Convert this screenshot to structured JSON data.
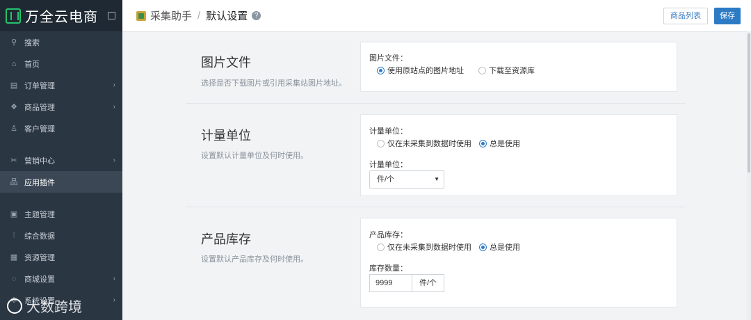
{
  "sidebar": {
    "brand": "万全云电商",
    "items": [
      {
        "label": "搜索"
      },
      {
        "label": "首页"
      },
      {
        "label": "订单管理"
      },
      {
        "label": "商品管理"
      },
      {
        "label": "客户管理"
      },
      {
        "label": "营销中心"
      },
      {
        "label": "应用插件"
      },
      {
        "label": "主题管理"
      },
      {
        "label": "综合数据"
      },
      {
        "label": "资源管理"
      },
      {
        "label": "商城设置"
      },
      {
        "label": "系统设置"
      }
    ],
    "watermark": "大数跨境"
  },
  "header": {
    "breadcrumb_app": "采集助手",
    "breadcrumb_sep": "/",
    "breadcrumb_current": "默认设置",
    "help_glyph": "?",
    "product_list_label": "商品列表",
    "save_label": "保存"
  },
  "sections": {
    "image": {
      "title": "图片文件",
      "desc": "选择是否下载图片或引用采集站图片地址。",
      "field_label": "图片文件：",
      "option_a": "使用原站点的图片地址",
      "option_b": "下载至资源库"
    },
    "unit": {
      "title": "计量单位",
      "desc": "设置默认计量单位及何时使用。",
      "field_label": "计量单位：",
      "option_a": "仅在未采集到数据时使用",
      "option_b": "总是使用",
      "select_label": "计量单位：",
      "select_value": "件/个"
    },
    "stock": {
      "title": "产品库存",
      "desc": "设置默认产品库存及何时使用。",
      "field_label": "产品库存：",
      "option_a": "仅在未采集到数据时使用",
      "option_b": "总是使用",
      "qty_label": "库存数量：",
      "qty_value": "9999",
      "qty_unit": "件/个"
    }
  },
  "colors": {
    "sidebar_bg": "#2b3643",
    "accent": "#2d7bc5",
    "brand_green": "#27c26c"
  }
}
